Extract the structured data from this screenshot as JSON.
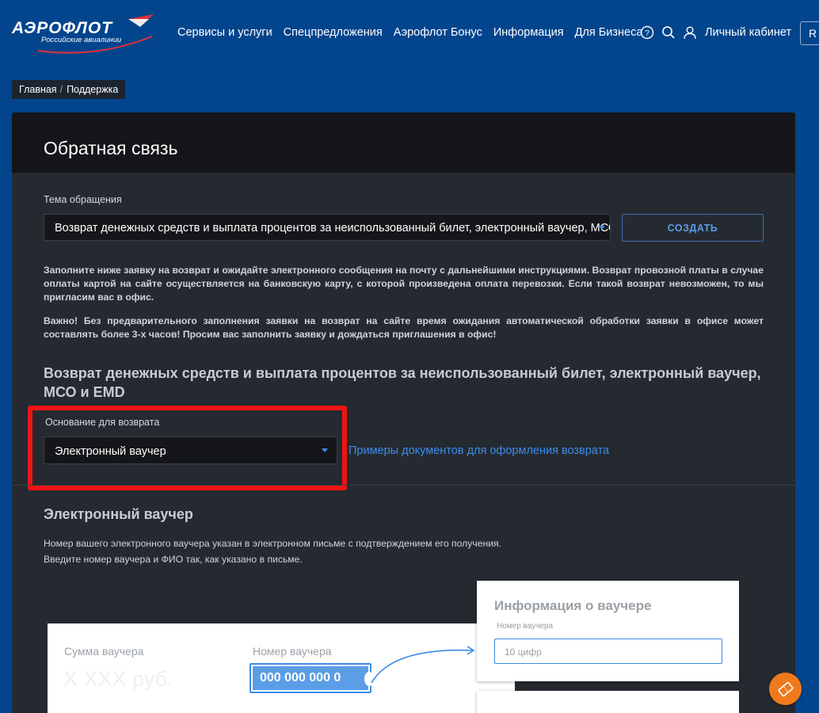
{
  "header": {
    "logo_text": "АЭРОФЛОТ",
    "logo_sub": "Российские авиалинии",
    "nav": [
      "Сервисы и услуги",
      "Спецпредложения",
      "Аэрофлот Бонус",
      "Информация",
      "Для Бизнеса"
    ],
    "cabinet": "Личный кабинет",
    "lang": "R"
  },
  "breadcrumb": {
    "home": "Главная",
    "sep": "/",
    "current": "Поддержка"
  },
  "form": {
    "title": "Обратная связь",
    "topic_label": "Тема обращения",
    "topic_value": "Возврат денежных средств и выплата процентов за неиспользованный билет, электронный ваучер, МСО и EMD",
    "create_button": "СОЗДАТЬ",
    "info_1": "Заполните ниже заявку на возврат и ожидайте электронного сообщения на почту с дальнейшими инструкциями. Возврат провозной платы в случае оплаты картой на сайте осуществляется на банковскую карту, с которой произведена оплата перевозки. Если такой возврат невозможен, то мы пригласим вас в офис.",
    "info_2": "Важно! Без предварительного заполнения заявки на возврат на сайте время ожидания автоматической обработки заявки в офисе может составлять более 3-х часов! Просим вас заполнить заявку и дождаться приглашения в офис!",
    "section_title": "Возврат денежных средств и выплата процентов за неиспользованный билет, электронный ваучер, МСО и EMD",
    "reason_label": "Основание для возврата",
    "reason_value": "Электронный ваучер",
    "examples_link": "Примеры документов для оформления возврата",
    "voucher_title": "Электронный ваучер",
    "voucher_desc_1": "Номер вашего электронного ваучера указан в электронном письме с подтверждением его получения.",
    "voucher_desc_2": "Введите номер ваучера и ФИО так, как указано в письме."
  },
  "illustration": {
    "amount_label": "Сумма ваучера",
    "amount_value": "X XXX руб.",
    "number_label": "Номер ваучера",
    "number_value": "000 000 000 0",
    "info_title": "Информация о ваучере",
    "info_field_label": "Номер ваучера",
    "info_field_placeholder": "10 цифр"
  },
  "colors": {
    "page_bg": "#02458d",
    "panel_bg": "#252a31",
    "accent": "#3d8be8",
    "highlight": "#f01414",
    "fab": "#f07a1b"
  }
}
